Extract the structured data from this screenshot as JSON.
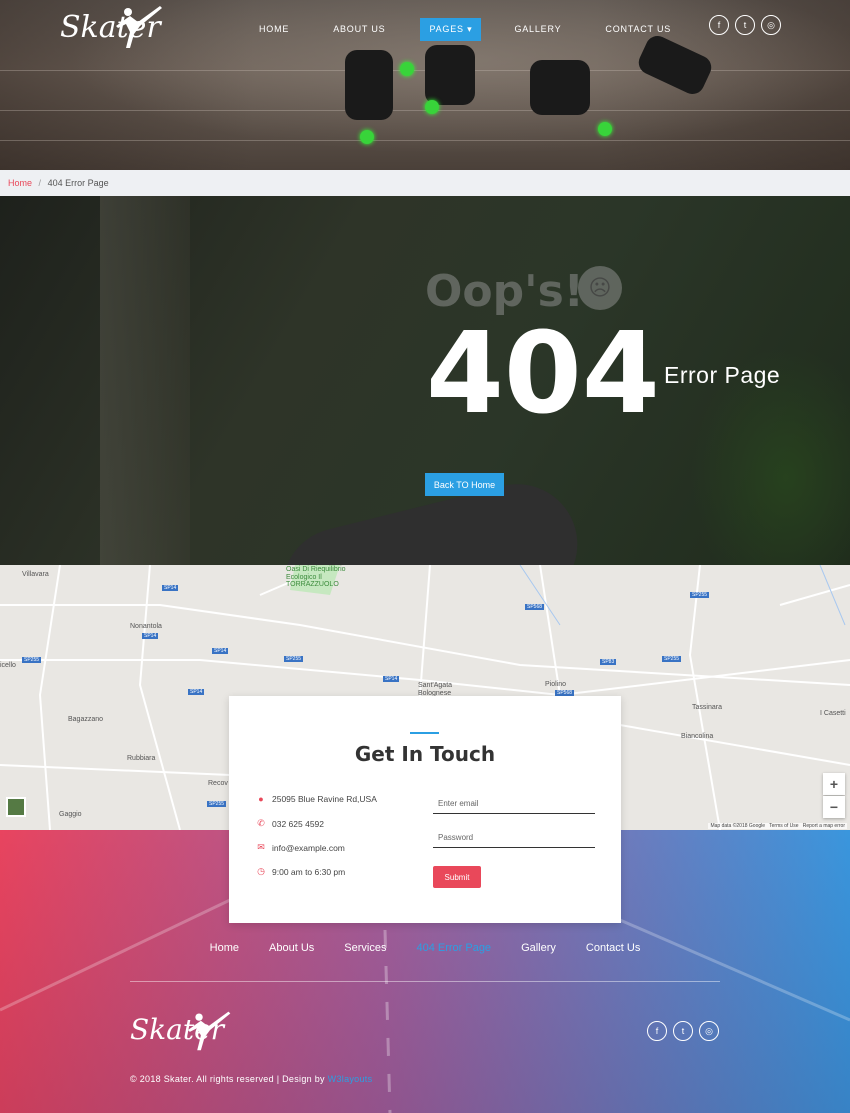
{
  "header": {
    "logo_text": "Skater",
    "nav": [
      {
        "label": "HOME"
      },
      {
        "label": "ABOUT US"
      },
      {
        "label": "PAGES"
      },
      {
        "label": "GALLERY"
      },
      {
        "label": "CONTACT US"
      }
    ],
    "social_icons": [
      "facebook-icon",
      "twitter-icon",
      "dribbble-icon"
    ]
  },
  "breadcrumb": {
    "home": "Home",
    "separator": "/",
    "current": "404 Error Page"
  },
  "error": {
    "oops": "Oop's!",
    "code": "404",
    "label": "Error Page",
    "button": "Back TO Home"
  },
  "map": {
    "places": [
      "Villavara",
      "Nonantola",
      "Bagazzano",
      "Rubbiara",
      "Gaggio",
      "Recov",
      "Sant'Agata Bolognese",
      "Piolino",
      "Tassinara",
      "Biancolina",
      "I Casetti",
      "Oasi Di Riequilibrio Ecologico Il TORRAZZUOLO",
      "icello"
    ],
    "roads": [
      "SP14",
      "SP255",
      "SP14",
      "SP255",
      "SP255",
      "SP14",
      "SP14",
      "SP568",
      "SP568",
      "SP83",
      "SP255",
      "SP255",
      "SP14"
    ],
    "attribution": [
      "Map data ©2018 Google",
      "Terms of Use",
      "Report a map error"
    ],
    "zoom_in": "+",
    "zoom_out": "−"
  },
  "contact": {
    "title": "Get In Touch",
    "address": "25095 Blue Ravine Rd,USA",
    "phone": "032 625 4592",
    "email": "info@example.com",
    "hours": "9:00 am to 6:30 pm",
    "email_placeholder": "Enter email",
    "password_placeholder": "Password",
    "submit": "Submit"
  },
  "footer": {
    "nav": [
      {
        "label": "Home"
      },
      {
        "label": "About Us"
      },
      {
        "label": "Services"
      },
      {
        "label": "404 Error Page"
      },
      {
        "label": "Gallery"
      },
      {
        "label": "Contact Us"
      }
    ],
    "logo_text": "Skater",
    "copyright": "© 2018 Skater. All rights reserved | Design by",
    "designer": "W3layouts"
  },
  "colors": {
    "accent_blue": "#2b9fe3",
    "accent_red": "#e9485a"
  }
}
